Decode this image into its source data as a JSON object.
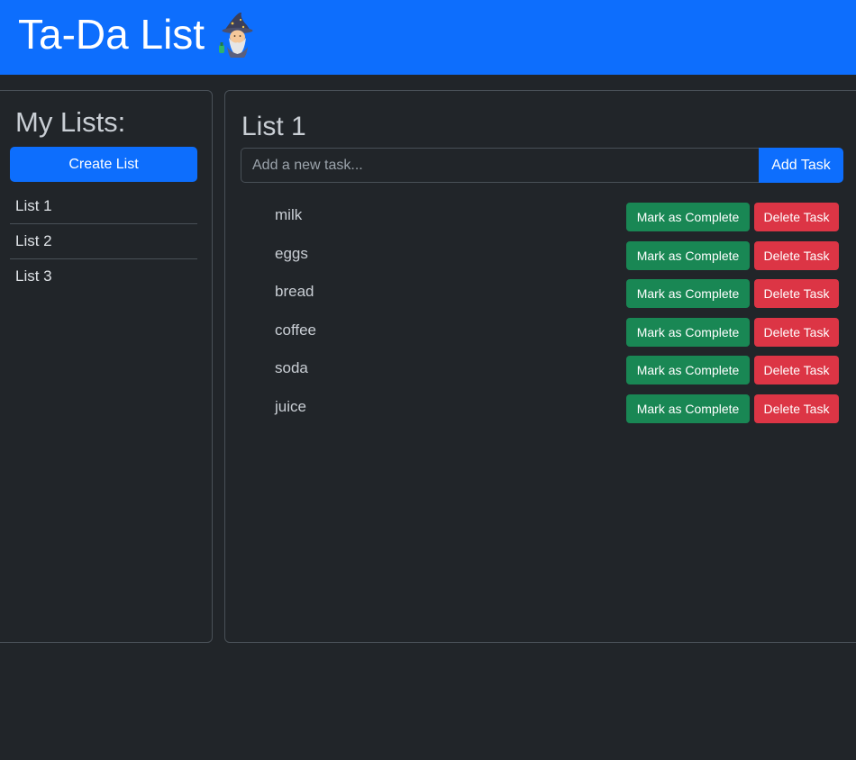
{
  "header": {
    "title": "Ta-Da List",
    "logo_icon": "wizard-icon",
    "background_color": "#0d6efd"
  },
  "sidebar": {
    "title": "My Lists:",
    "create_button_label": "Create List",
    "lists": [
      {
        "label": "List 1"
      },
      {
        "label": "List 2"
      },
      {
        "label": "List 3"
      }
    ]
  },
  "main": {
    "list_title": "List 1",
    "new_task_placeholder": "Add a new task...",
    "new_task_value": "",
    "add_button_label": "Add Task",
    "complete_button_label": "Mark as Complete",
    "delete_button_label": "Delete Task",
    "tasks": [
      {
        "name": "milk"
      },
      {
        "name": "eggs"
      },
      {
        "name": "bread"
      },
      {
        "name": "coffee"
      },
      {
        "name": "soda"
      },
      {
        "name": "juice"
      }
    ]
  },
  "colors": {
    "primary": "#0d6efd",
    "success": "#198754",
    "danger": "#dc3545",
    "background": "#212529"
  }
}
